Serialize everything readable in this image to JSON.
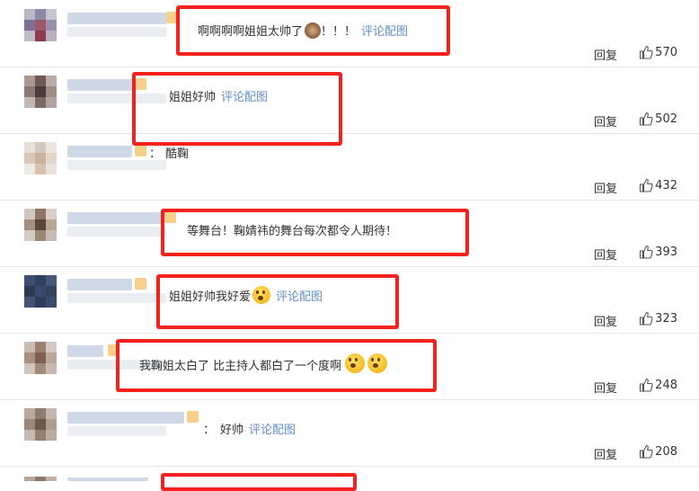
{
  "reply_label": "回复",
  "link_label": "评论配图",
  "colors": {
    "accent_link": "#5f8fc9",
    "highlight_box": "#f4221d"
  },
  "comments": [
    {
      "text": "啊啊啊啊姐姐太帅了",
      "emoji": "monkey-emoji",
      "after_emoji": "！！！",
      "has_link": true,
      "likes": "570"
    },
    {
      "text": "姐姐好帅",
      "has_link": true,
      "likes": "502"
    },
    {
      "colon": "：",
      "text": "酷鞠",
      "likes": "432"
    },
    {
      "text": "等舞台！鞠婧祎的舞台每次都令人期待！",
      "likes": "393"
    },
    {
      "text": "姐姐好帅我好爱",
      "emoji": "smile-emoji",
      "has_link": true,
      "likes": "323"
    },
    {
      "text": "我鞠姐太白了 比主持人都白了一个度啊",
      "emoji": "shocked-emoji",
      "likes": "248"
    },
    {
      "colon": "：",
      "text": "好帅",
      "has_link": true,
      "likes": "208"
    }
  ]
}
